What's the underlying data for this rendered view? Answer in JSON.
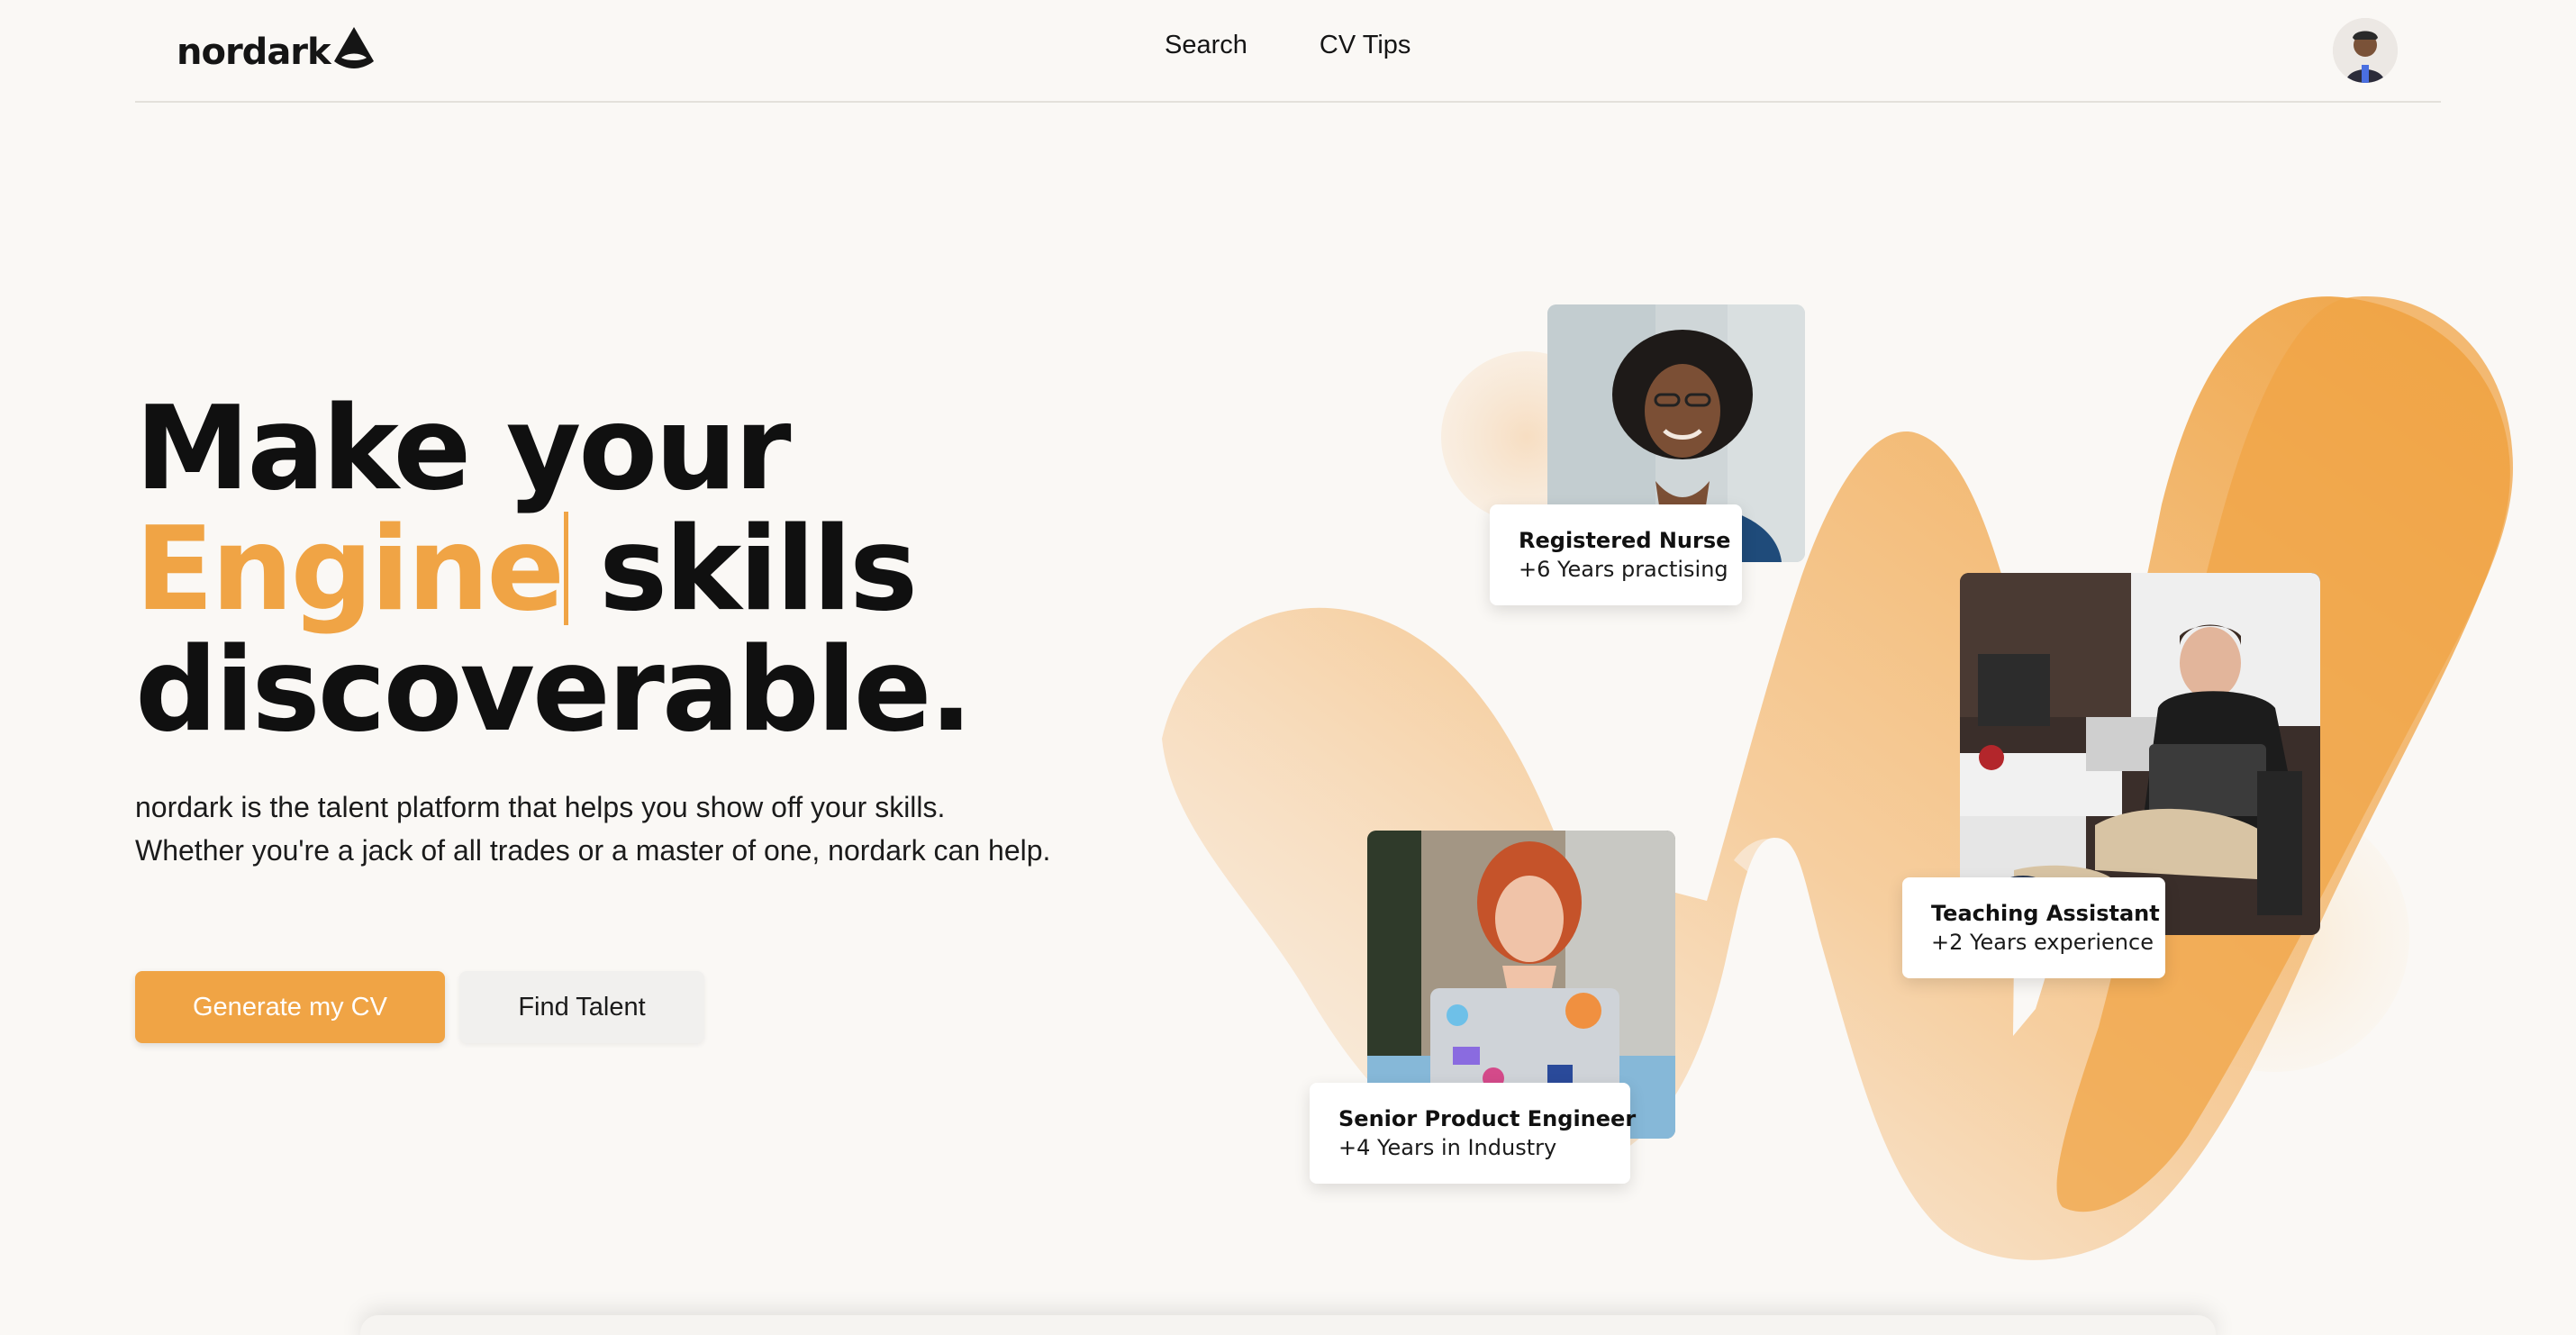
{
  "header": {
    "logo_text": "nordark",
    "nav": [
      {
        "label": "Search"
      },
      {
        "label": "CV Tips"
      }
    ]
  },
  "hero": {
    "title_line1": "Make your",
    "title_accent_word": "Engine",
    "title_line2_rest": "skills",
    "title_line3": "discoverable.",
    "description_line1": "nordark is the talent platform that helps you show off your skills.",
    "description_line2": "Whether you're a jack of all trades or a master of one, nordark can help.",
    "primary_button": "Generate my CV",
    "secondary_button": "Find Talent"
  },
  "profiles": [
    {
      "title": "Registered Nurse",
      "subtitle": "+6 Years practising"
    },
    {
      "title": "Teaching Assistant",
      "subtitle": "+2 Years experience"
    },
    {
      "title": "Senior Product Engineer",
      "subtitle": "+4 Years in Industry"
    }
  ],
  "colors": {
    "accent": "#f0a445",
    "background": "#faf8f5",
    "text": "#111111"
  },
  "icons": {
    "logo_mark": "nordark-peak-icon",
    "avatar": "user-avatar"
  }
}
